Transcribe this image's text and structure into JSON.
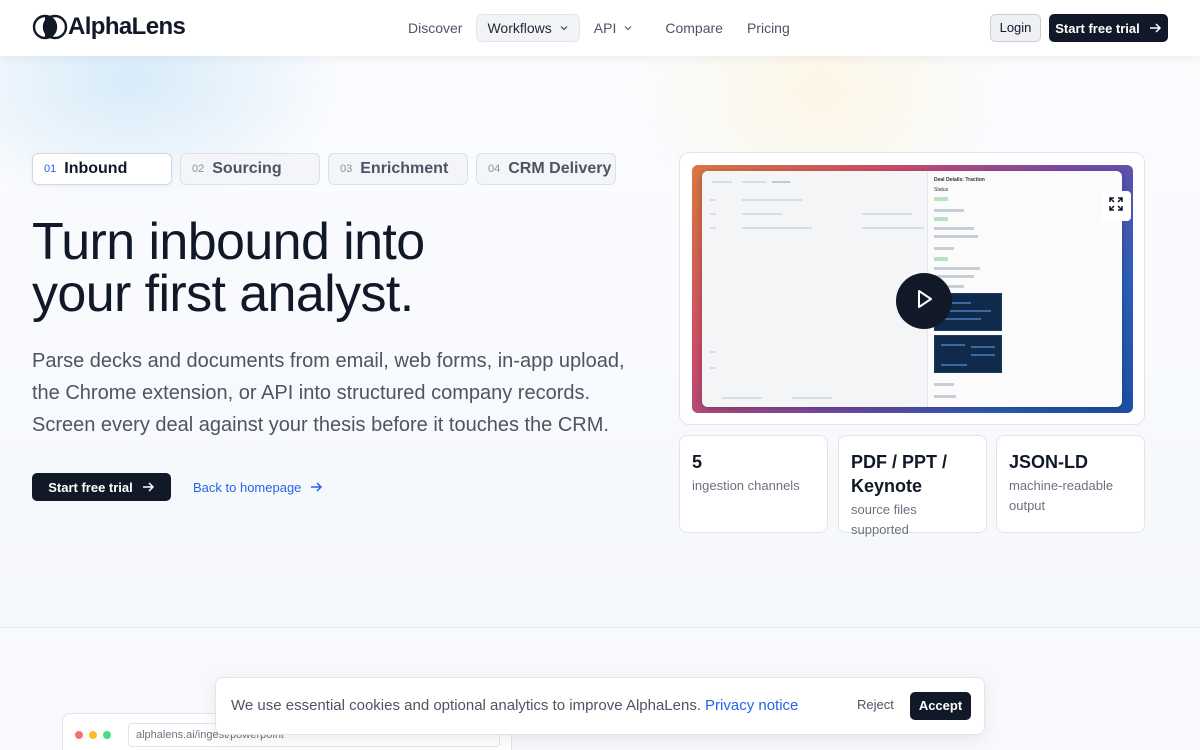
{
  "brand": {
    "name": "AlphaLens"
  },
  "nav": {
    "links": [
      {
        "label": "Discover"
      },
      {
        "label": "Workflows"
      },
      {
        "label": "API"
      },
      {
        "label": "Compare"
      },
      {
        "label": "Pricing"
      }
    ],
    "login_label": "Login",
    "trial_label": "Start free trial"
  },
  "steps": [
    {
      "num": "01",
      "label": "Inbound"
    },
    {
      "num": "02",
      "label": "Sourcing"
    },
    {
      "num": "03",
      "label": "Enrichment"
    },
    {
      "num": "04",
      "label": "CRM Delivery"
    }
  ],
  "hero": {
    "headline_line1": "Turn inbound into",
    "headline_line2": "your first analyst.",
    "subtext": "Parse decks and documents from email, web forms, in-app upload, the Chrome extension, or API into structured company records. Screen every deal against your thesis before it touches the CRM.",
    "cta_label": "Start free trial",
    "back_label": "Back to homepage"
  },
  "video": {
    "panel_title": "Deal Details: Traction",
    "panel_status": "Status"
  },
  "stats": [
    {
      "value": "5",
      "label": "ingestion channels"
    },
    {
      "value": "PDF / PPT / Keynote",
      "label": "source files supported"
    },
    {
      "value": "JSON-LD",
      "label": "machine-readable output"
    }
  ],
  "bottom": {
    "url": "alphalens.ai/ingest/powerpoint"
  },
  "cookie": {
    "text": "We use essential cookies and optional analytics to improve AlphaLens.",
    "link": "Privacy notice",
    "reject_label": "Reject",
    "accept_label": "Accept"
  },
  "colors": {
    "accent": "#2563eb",
    "dark": "#111827"
  }
}
